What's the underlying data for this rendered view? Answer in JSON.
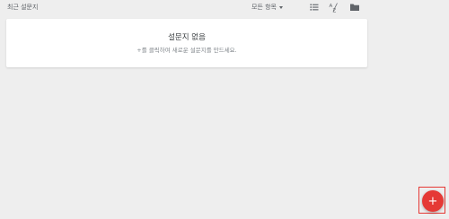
{
  "header": {
    "section_title": "최근 설문지",
    "filter": {
      "selected": "모든 항목"
    },
    "tools": {
      "list_view": "list-view-icon",
      "sort": "sort-az-icon",
      "folder": "folder-icon"
    }
  },
  "empty_state": {
    "title": "설문지 없음",
    "hint": "+를 클릭하여 새로운 설문지를 만드세요."
  },
  "fab": {
    "label": "+",
    "color": "#e53935"
  },
  "colors": {
    "background": "#eeeeee",
    "card": "#ffffff",
    "accent": "#e53935"
  }
}
